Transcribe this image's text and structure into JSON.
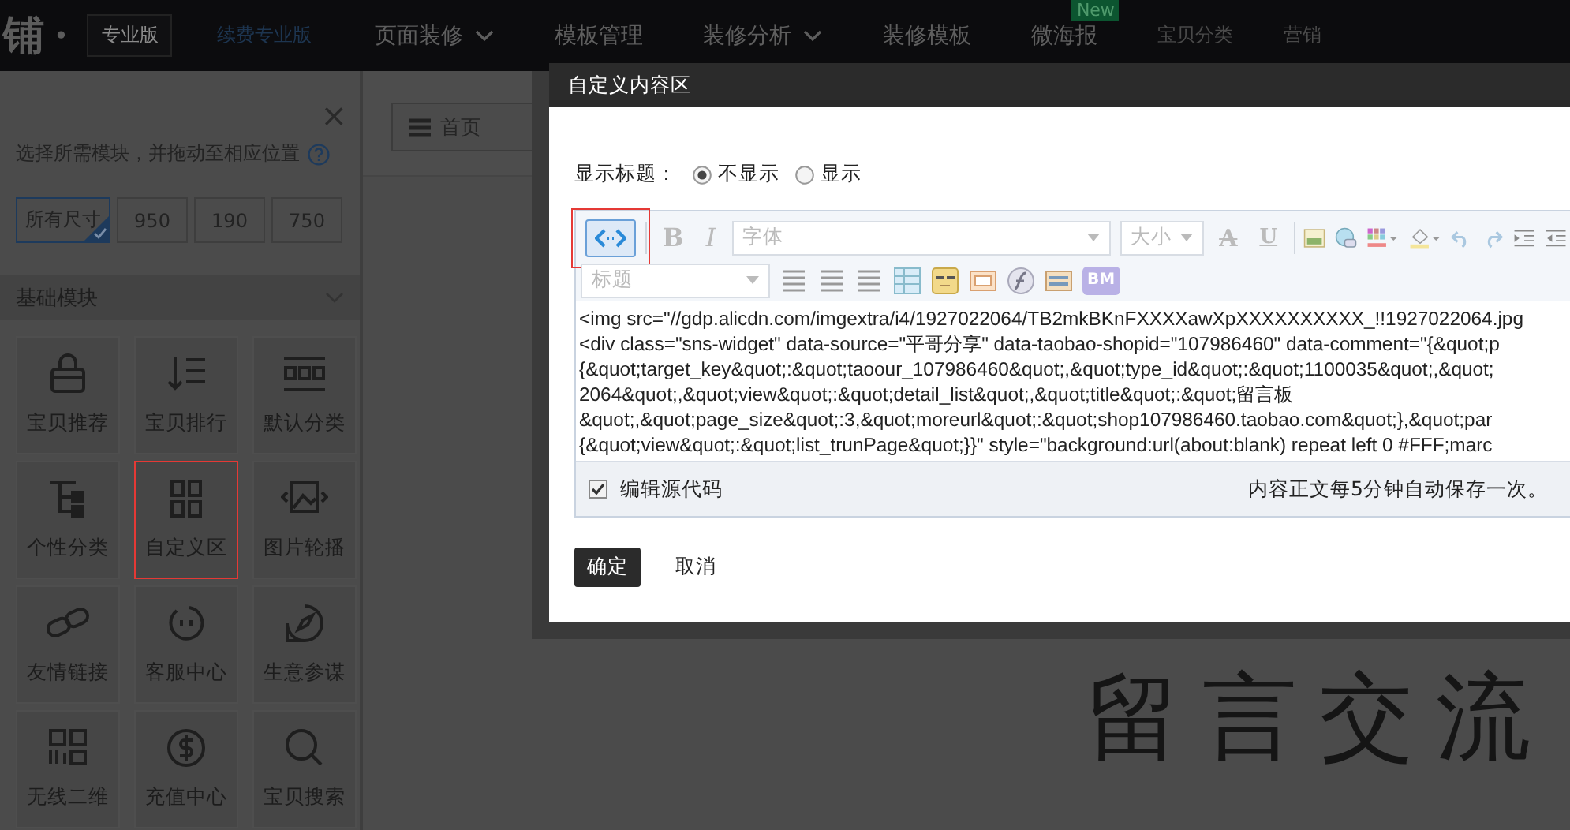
{
  "nav": {
    "logo": "铺",
    "logo_dot": "•",
    "edition": "专业版",
    "renew_link": "续费专业版",
    "items": [
      {
        "label": "页面装修",
        "dropdown": true,
        "dim": false
      },
      {
        "label": "模板管理",
        "dropdown": false,
        "dim": false
      },
      {
        "label": "装修分析",
        "dropdown": true,
        "dim": false
      },
      {
        "label": "装修模板",
        "dropdown": false,
        "dim": false
      },
      {
        "label": "微海报",
        "dropdown": false,
        "dim": false,
        "badge": "New"
      },
      {
        "label": "宝贝分类",
        "dropdown": false,
        "dim": true
      },
      {
        "label": "营销",
        "dropdown": false,
        "dim": true
      }
    ]
  },
  "sidebar": {
    "close": "×",
    "instruction": "选择所需模块，并拖动至相应位置",
    "size_filters": [
      {
        "label": "所有尺寸",
        "selected": true
      },
      {
        "label": "950",
        "selected": false
      },
      {
        "label": "190",
        "selected": false
      },
      {
        "label": "750",
        "selected": false
      }
    ],
    "section": {
      "title": "基础模块",
      "expanded": true
    },
    "modules": [
      {
        "label": "宝贝推荐",
        "kind": "bag",
        "highlighted": false
      },
      {
        "label": "宝贝排行",
        "kind": "rank",
        "highlighted": false
      },
      {
        "label": "默认分类",
        "kind": "category",
        "highlighted": false
      },
      {
        "label": "个性分类",
        "kind": "tree",
        "highlighted": false
      },
      {
        "label": "自定义区",
        "kind": "grid",
        "highlighted": true
      },
      {
        "label": "图片轮播",
        "kind": "slider",
        "highlighted": false
      },
      {
        "label": "友情链接",
        "kind": "link",
        "highlighted": false
      },
      {
        "label": "客服中心",
        "kind": "service",
        "highlighted": false
      },
      {
        "label": "生意参谋",
        "kind": "compass",
        "highlighted": false
      },
      {
        "label": "无线二维",
        "kind": "qr",
        "highlighted": false
      },
      {
        "label": "充值中心",
        "kind": "dollar",
        "highlighted": false
      },
      {
        "label": "宝贝搜索",
        "kind": "search",
        "highlighted": false
      }
    ]
  },
  "page": {
    "home_button": "首页",
    "banner_text": "留言交流"
  },
  "dialog": {
    "title": "自定义内容区",
    "show_title_label": "显示标题：",
    "show_title_options": [
      {
        "label": "不显示",
        "selected": true
      },
      {
        "label": "显示",
        "selected": false
      }
    ],
    "source_button": {
      "selected": true,
      "highlighted": true
    },
    "toolbar_rows": [
      [
        {
          "kind": "code"
        },
        {
          "kind": "sep"
        },
        {
          "kind": "bold",
          "label": "B"
        },
        {
          "kind": "italic",
          "label": "I"
        },
        {
          "kind": "select",
          "label": "字体"
        },
        {
          "kind": "select-small",
          "label": "大小"
        },
        {
          "kind": "strike",
          "label": "A"
        },
        {
          "kind": "underline",
          "label": "U"
        },
        {
          "kind": "sep"
        },
        {
          "kind": "image"
        },
        {
          "kind": "link"
        },
        {
          "kind": "color"
        },
        {
          "kind": "fill"
        },
        {
          "kind": "undo"
        },
        {
          "kind": "redo"
        },
        {
          "kind": "indent"
        },
        {
          "kind": "outdent"
        }
      ],
      [
        {
          "kind": "select",
          "label": "标题"
        },
        {
          "kind": "align"
        },
        {
          "kind": "align"
        },
        {
          "kind": "align"
        },
        {
          "kind": "table"
        },
        {
          "kind": "emoticon"
        },
        {
          "kind": "picture"
        },
        {
          "kind": "flash"
        },
        {
          "kind": "layout"
        },
        {
          "kind": "text-icon",
          "label": "BM"
        }
      ]
    ],
    "source_lines": [
      "<img src=\"//gdp.alicdn.com/imgextra/i4/1927022064/TB2mkBKnFXXXXawXpXXXXXXXXXX_!!1927022064.jpg",
      "<div class=\"sns-widget\" data-source=\"平哥分享\" data-taobao-shopid=\"107986460\" data-comment=\"{&quot;p",
      "{&quot;target_key&quot;:&quot;taoour_107986460&quot;,&quot;type_id&quot;:&quot;1100035&quot;,&quot;",
      "2064&quot;,&quot;view&quot;:&quot;detail_list&quot;,&quot;title&quot;:&quot;留言板",
      "&quot;,&quot;page_size&quot;:3,&quot;moreurl&quot;:&quot;shop107986460.taobao.com&quot;},&quot;par",
      "{&quot;view&quot;:&quot;list_trunPage&quot;}}\" style=\"background:url(about:blank) repeat left 0 #FFF;marc"
    ],
    "edit_source": {
      "label": "编辑源代码",
      "checked": true
    },
    "autosave_note": "内容正文每5分钟自动保存一次。",
    "buttons": [
      {
        "label": "确定",
        "primary": true
      },
      {
        "label": "取消",
        "primary": false
      }
    ]
  }
}
